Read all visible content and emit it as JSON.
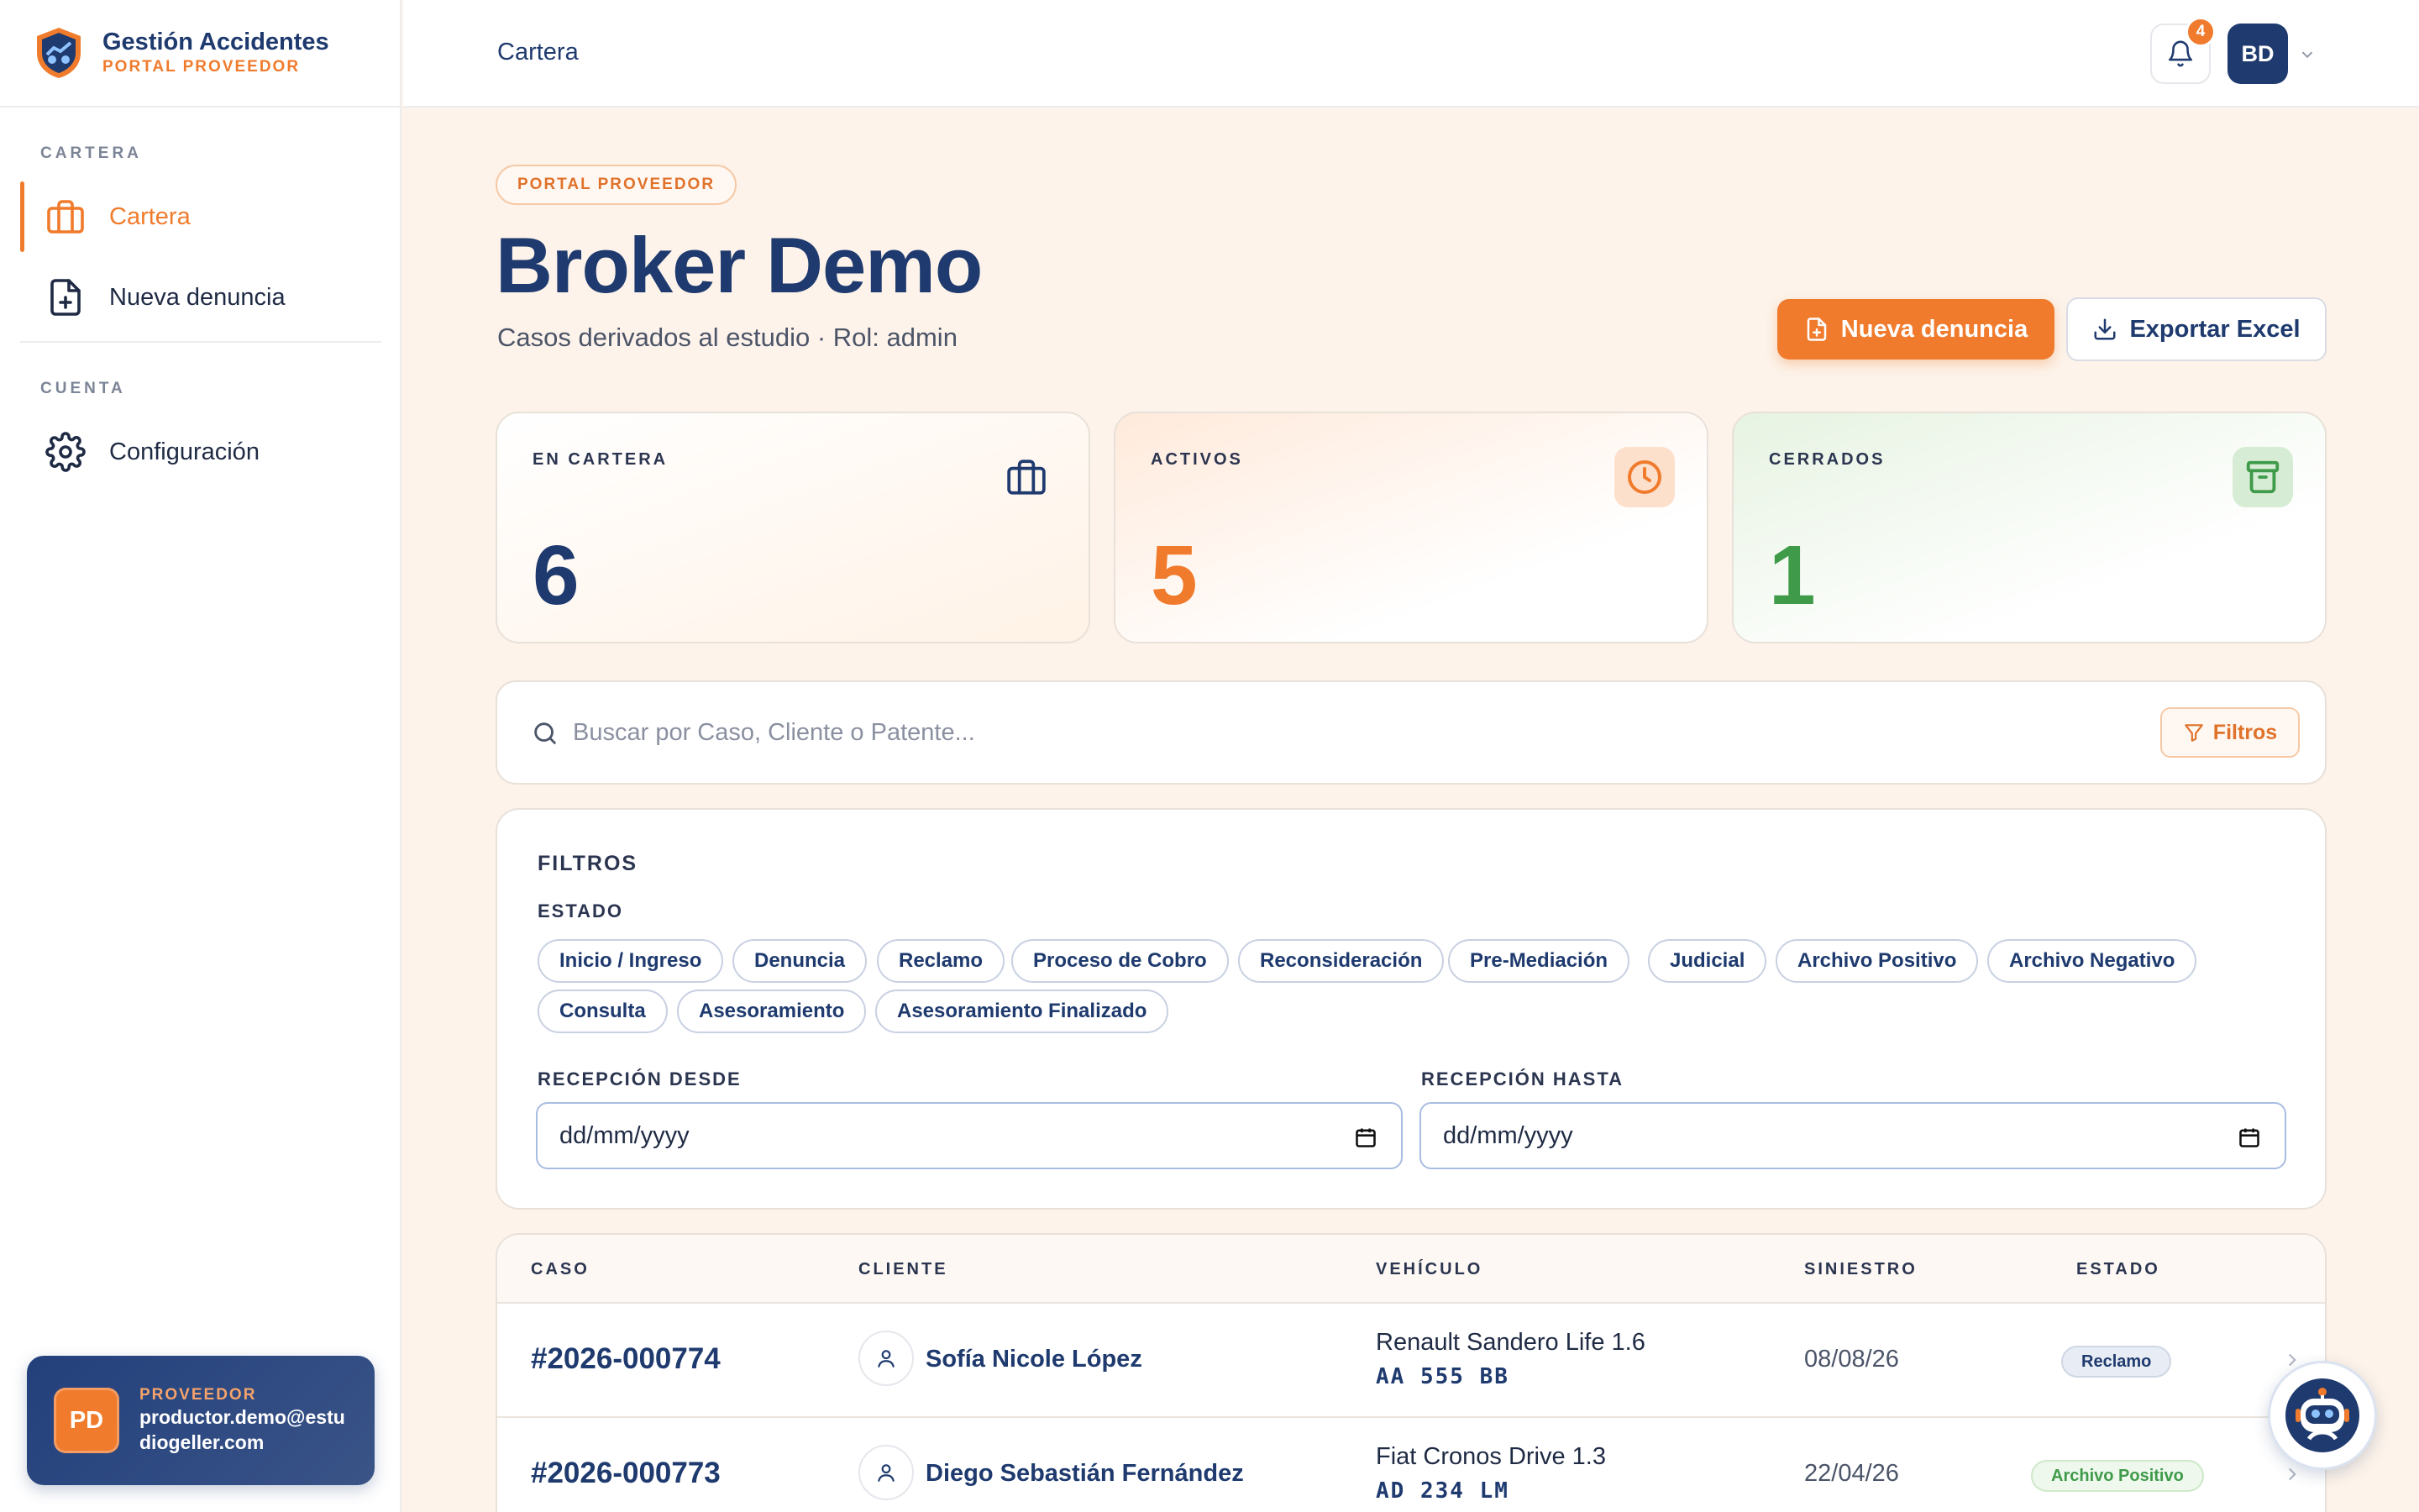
{
  "brand": {
    "title": "Gestión Accidentes",
    "subtitle": "PORTAL PROVEEDOR"
  },
  "sidebar": {
    "sections": [
      {
        "label": "CARTERA"
      },
      {
        "label": "CUENTA"
      }
    ],
    "items": [
      {
        "label": "Cartera",
        "icon": "briefcase-icon",
        "active": true
      },
      {
        "label": "Nueva denuncia",
        "icon": "file-plus-icon"
      },
      {
        "label": "Configuración",
        "icon": "gear-icon"
      }
    ],
    "user": {
      "initials": "PD",
      "role": "PROVEEDOR",
      "email": "productor.demo@estudiogeller.com"
    }
  },
  "topbar": {
    "breadcrumb": "Cartera",
    "notifications": "4",
    "avatar": "BD"
  },
  "header": {
    "pill": "PORTAL PROVEEDOR",
    "title": "Broker Demo",
    "subtitle": "Casos derivados al estudio · Rol: admin",
    "primary_button": "Nueva denuncia",
    "secondary_button": "Exportar Excel"
  },
  "stats": [
    {
      "label": "EN CARTERA",
      "value": "6",
      "icon": "briefcase-icon",
      "color": "#1e3a6e"
    },
    {
      "label": "ACTIVOS",
      "value": "5",
      "icon": "clock-icon",
      "color": "#f07b2c"
    },
    {
      "label": "CERRADOS",
      "value": "1",
      "icon": "archive-icon",
      "color": "#3f9a4a"
    }
  ],
  "search": {
    "placeholder": "Buscar por Caso, Cliente o Patente...",
    "filter_button": "Filtros"
  },
  "filters": {
    "title": "FILTROS",
    "estado_label": "ESTADO",
    "chips": [
      "Inicio / Ingreso",
      "Denuncia",
      "Reclamo",
      "Proceso de Cobro",
      "Reconsideración",
      "Pre-Mediación",
      "Judicial",
      "Archivo Positivo",
      "Archivo Negativo",
      "Consulta",
      "Asesoramiento",
      "Asesoramiento Finalizado"
    ],
    "from_label": "RECEPCIÓN DESDE",
    "to_label": "RECEPCIÓN HASTA",
    "from_value": "dd/mm/yyyy",
    "to_value": "dd/mm/yyyy"
  },
  "table": {
    "columns": [
      "CASO",
      "CLIENTE",
      "VEHÍCULO",
      "SINIESTRO",
      "ESTADO"
    ],
    "rows": [
      {
        "caso": "#2026-000774",
        "cliente": "Sofía Nicole López",
        "vehiculo": "Renault Sandero Life 1.6",
        "patente": "AA 555 BB",
        "siniestro": "08/08/26",
        "estado": "Reclamo"
      },
      {
        "caso": "#2026-000773",
        "cliente": "Diego Sebastián Fernández",
        "vehiculo": "Fiat Cronos Drive 1.3",
        "patente": "AD 234 LM",
        "siniestro": "22/04/26",
        "estado": "Archivo Positivo"
      }
    ]
  },
  "colors": {
    "accent": "#f07b2c",
    "brand": "#1e3a6e",
    "success": "#3f9a4a"
  }
}
